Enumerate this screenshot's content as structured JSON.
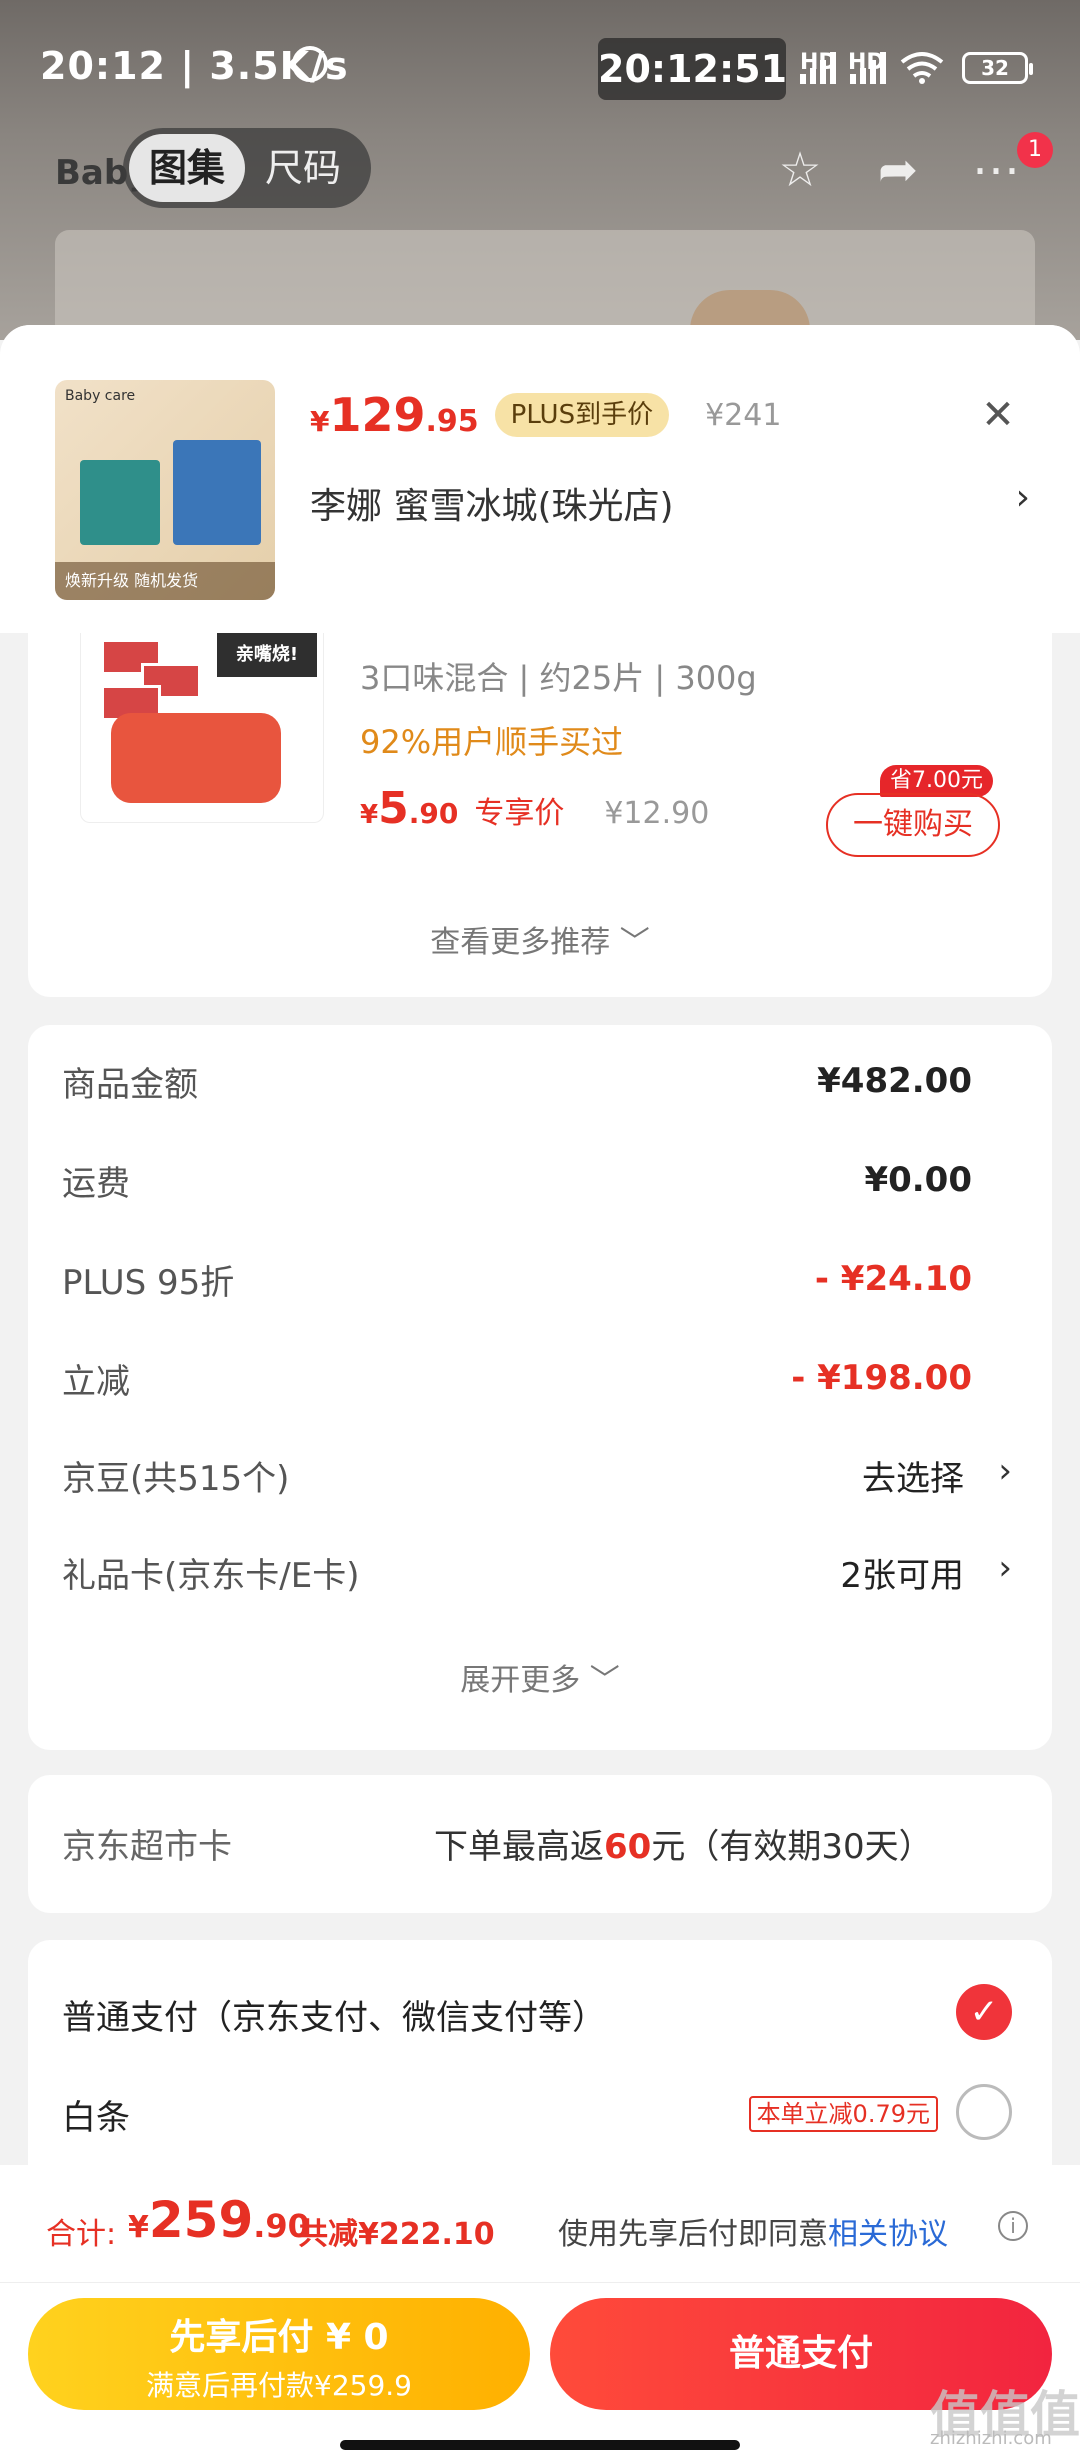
{
  "status_bar": {
    "time": "20:12",
    "net_speed": "3.5K/s",
    "clock": "20:12:51",
    "sig1": "HD",
    "sig2": "HD",
    "battery": "32"
  },
  "nav": {
    "logo": "Baby care",
    "tabs": [
      "图集",
      "尺码"
    ],
    "badge": "1"
  },
  "product": {
    "price_symbol": "¥",
    "price_int": "129",
    "price_dec": ".95",
    "plus_tag": "PLUS到手价",
    "original_price": "¥241",
    "thumb_caption": "焕新升级 随机发货",
    "thumb_logo": "Baby care",
    "shop": "李娜  蜜雪冰城(珠光店)"
  },
  "recommend": {
    "image_label": "亲嘴烧!",
    "spec": "3口味混合 | 约25片 | 300g",
    "bought": "92%用户顺手买过",
    "price_symbol": "¥",
    "price_int": "5",
    "price_dec": ".90",
    "price_tag": "专享价",
    "original_price": "¥12.90",
    "save_tag": "省7.00元",
    "buy_button": "一键购买",
    "more": "查看更多推荐 ﹀"
  },
  "fees": {
    "rows": [
      {
        "label": "商品金额",
        "value": "¥482.00"
      },
      {
        "label": "运费",
        "value": "¥0.00"
      },
      {
        "label": "PLUS 95折",
        "value": "- ¥24.10"
      },
      {
        "label": "立减",
        "value": "- ¥198.00"
      },
      {
        "label": "京豆(共515个)",
        "value": "去选择"
      },
      {
        "label": "礼品卡(京东卡/E卡)",
        "value": "2张可用"
      }
    ],
    "more": "展开更多 ﹀"
  },
  "market_card": {
    "label": "京东超市卡",
    "text_before": "下单最高返",
    "amount": "60",
    "text_after": "元（有效期30天）"
  },
  "payment": {
    "options": [
      {
        "label": "普通支付（京东支付、微信支付等）"
      },
      {
        "label": "白条",
        "promo": "本单立减0.79元"
      }
    ]
  },
  "footer": {
    "total_label": "合计:",
    "total_symbol": "¥",
    "total_int": "259",
    "total_dec": ".90",
    "total_reduction": "共减¥222.10",
    "agree_text": "使用先享后付即同意",
    "agree_link": "相关协议",
    "btn_later_title": "先享后付 ¥ 0",
    "btn_later_sub": "满意后再付款¥259.9",
    "btn_pay": "普通支付"
  },
  "watermark": {
    "big": "值值值",
    "small": "zhizhizhi.com"
  }
}
